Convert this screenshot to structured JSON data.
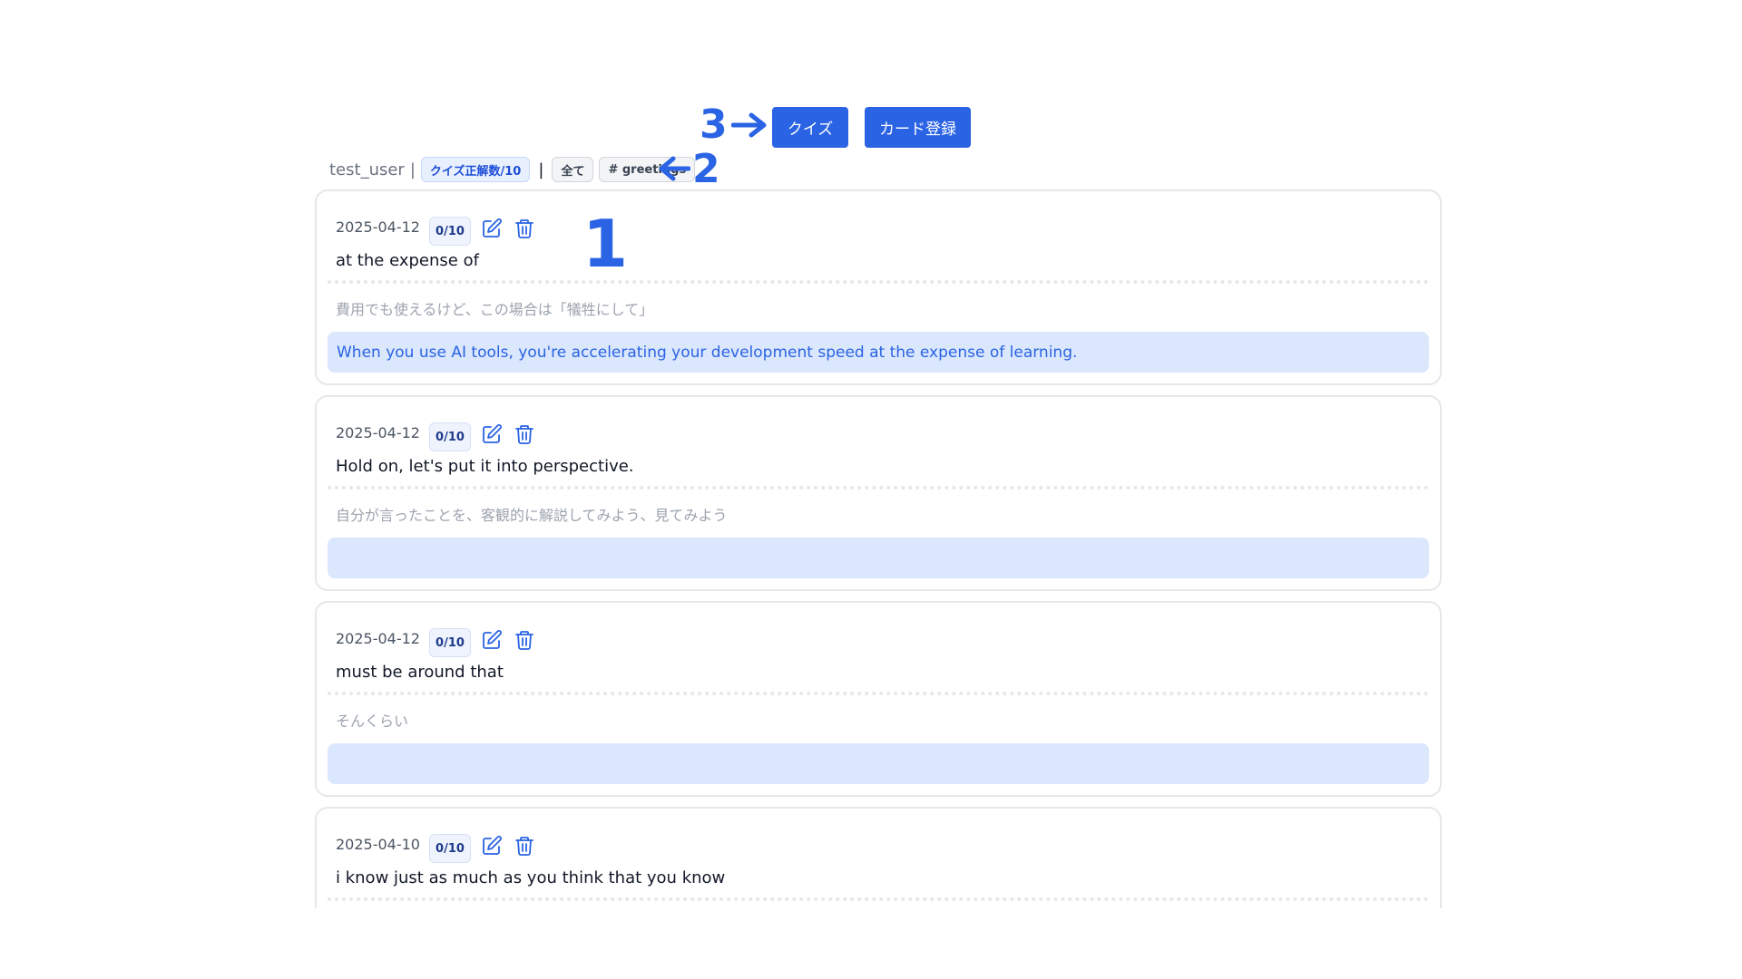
{
  "actions": {
    "quiz_label": "クイズ",
    "register_label": "カード登録"
  },
  "header": {
    "username": "test_user",
    "separator_1": "|",
    "quiz_score_tag": "クイズ正解数/10",
    "separator_2": "|",
    "filter_all": "全て",
    "filter_tag": "# greetings"
  },
  "annotations": {
    "label_1": "1",
    "label_2": "2",
    "label_3": "3"
  },
  "cards": [
    {
      "date": "2025-04-12",
      "score": "0/10",
      "phrase": "at the expense of",
      "meaning": "費用でも使えるけど、この場合は「犠牲にして」",
      "example": "When you use AI tools, you're accelerating your development speed at the expense of learning."
    },
    {
      "date": "2025-04-12",
      "score": "0/10",
      "phrase": "Hold on, let's put it into perspective.",
      "meaning": "自分が言ったことを、客観的に解説してみよう、見てみよう",
      "example": ""
    },
    {
      "date": "2025-04-12",
      "score": "0/10",
      "phrase": "must be around that",
      "meaning": "そんくらい",
      "example": ""
    },
    {
      "date": "2025-04-10",
      "score": "0/10",
      "phrase": "i know just as much as you think that you know",
      "meaning": "",
      "example": ""
    }
  ],
  "icons": {
    "edit": "edit-icon",
    "delete": "trash-icon"
  },
  "colors": {
    "accent": "#2a63e3",
    "example_bg": "#dbe7fd",
    "card_border": "#e5e7eb"
  }
}
